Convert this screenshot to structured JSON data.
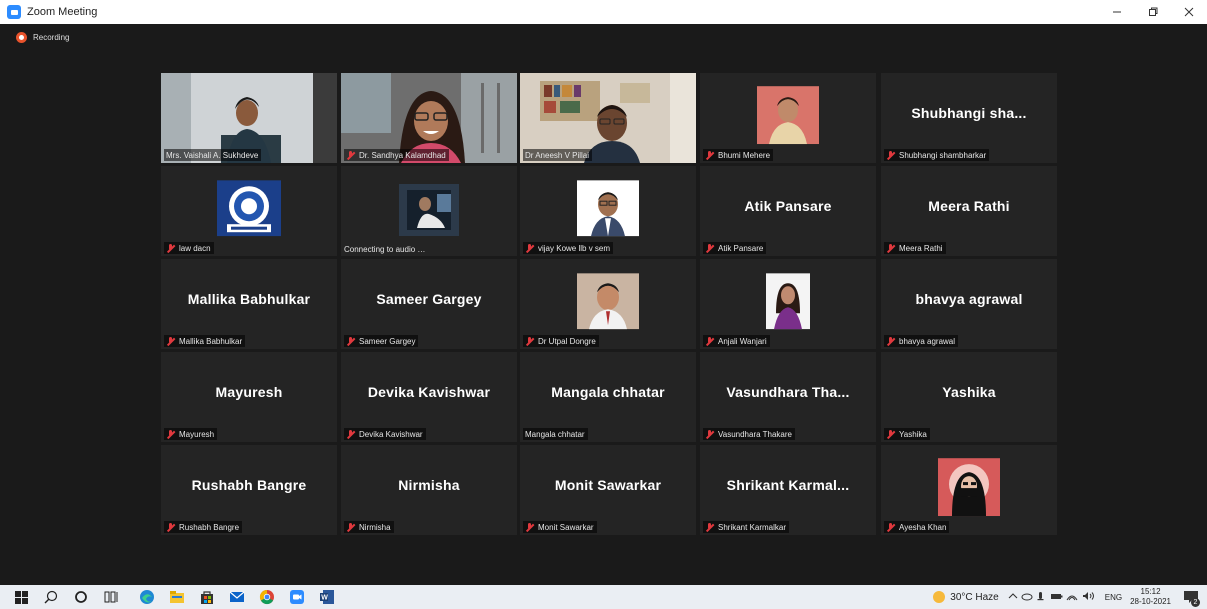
{
  "window": {
    "title": "Zoom Meeting"
  },
  "recording": {
    "label": "Recording"
  },
  "tiles": [
    {
      "big": "",
      "label": "Mrs. Vaishali A. Sukhdeve",
      "muted": false,
      "kind": "video1",
      "active": true
    },
    {
      "big": "",
      "label": "Dr. Sandhya Kalamdhad",
      "muted": true,
      "kind": "video2"
    },
    {
      "big": "",
      "label": "Dr Aneesh V Pillai",
      "muted": false,
      "kind": "video3"
    },
    {
      "big": "",
      "label": "Bhumi Mehere",
      "muted": true,
      "kind": "photo-bhumi"
    },
    {
      "big": "Shubhangi  sha...",
      "label": "Shubhangi shambharkar",
      "muted": true,
      "kind": "name"
    },
    {
      "big": "",
      "label": "law dacn",
      "muted": true,
      "kind": "logo"
    },
    {
      "big": "",
      "label": "Connecting to audio",
      "muted": false,
      "kind": "video-connecting"
    },
    {
      "big": "",
      "label": "vijay Kowe llb v sem",
      "muted": true,
      "kind": "photo-vijay"
    },
    {
      "big": "Atik Pansare",
      "label": "Atik Pansare",
      "muted": true,
      "kind": "name"
    },
    {
      "big": "Meera Rathi",
      "label": "Meera Rathi",
      "muted": true,
      "kind": "name"
    },
    {
      "big": "Mallika Babhulkar",
      "label": "Mallika Babhulkar",
      "muted": true,
      "kind": "name"
    },
    {
      "big": "Sameer Gargey",
      "label": "Sameer Gargey",
      "muted": true,
      "kind": "name"
    },
    {
      "big": "",
      "label": "Dr Utpal Dongre",
      "muted": true,
      "kind": "photo-utpal"
    },
    {
      "big": "",
      "label": "Anjali Wanjari",
      "muted": true,
      "kind": "photo-anjali"
    },
    {
      "big": "bhavya agrawal",
      "label": "bhavya agrawal",
      "muted": true,
      "kind": "name"
    },
    {
      "big": "Mayuresh",
      "label": "Mayuresh",
      "muted": true,
      "kind": "name"
    },
    {
      "big": "Devika Kavishwar",
      "label": "Devika Kavishwar",
      "muted": true,
      "kind": "name"
    },
    {
      "big": "Mangala chhatar",
      "label": "Mangala chhatar",
      "muted": false,
      "kind": "name"
    },
    {
      "big": "Vasundhara  Tha...",
      "label": "Vasundhara Thakare",
      "muted": true,
      "kind": "name"
    },
    {
      "big": "Yashika",
      "label": "Yashika",
      "muted": true,
      "kind": "name"
    },
    {
      "big": "Rushabh Bangre",
      "label": "Rushabh Bangre",
      "muted": true,
      "kind": "name"
    },
    {
      "big": "Nirmisha",
      "label": "Nirmisha",
      "muted": true,
      "kind": "name"
    },
    {
      "big": "Monit Sawarkar",
      "label": "Monit Sawarkar",
      "muted": true,
      "kind": "name"
    },
    {
      "big": "Shrikant  Karmal...",
      "label": "Shrikant Karmalkar",
      "muted": true,
      "kind": "name"
    },
    {
      "big": "",
      "label": "Ayesha Khan",
      "muted": true,
      "kind": "photo-ayesha"
    }
  ],
  "taskbar": {
    "weather": "30°C  Haze",
    "lang": "ENG",
    "time": "15:12",
    "date": "28-10-2021",
    "notif_count": "2"
  },
  "icons": [
    "windows-start-icon",
    "search-icon",
    "cortana-icon",
    "task-view-icon",
    "edge-icon",
    "file-explorer-icon",
    "store-icon",
    "mail-icon",
    "chrome-icon",
    "zoom-icon",
    "word-icon"
  ]
}
